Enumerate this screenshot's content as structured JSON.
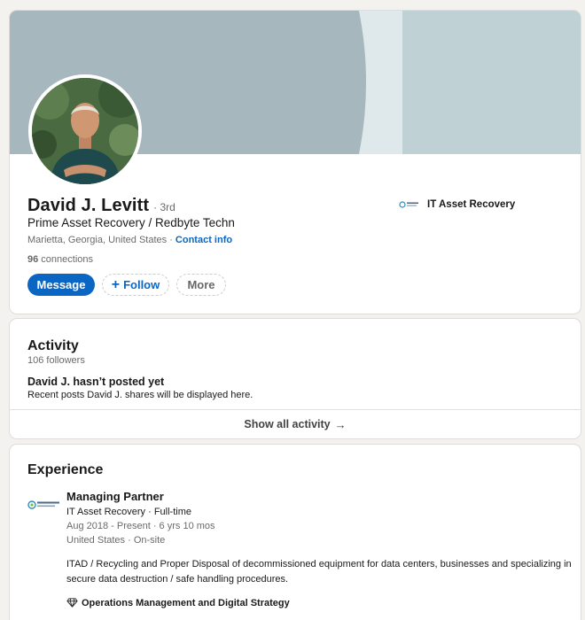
{
  "profile": {
    "name": "David J. Levitt",
    "degree": "· 3rd",
    "headline": "Prime Asset Recovery / Redbyte Techn",
    "location": "Marietta, Georgia, United States",
    "location_sep": " · ",
    "contact_label": "Contact info",
    "connections_count": "96",
    "connections_label": " connections",
    "current_company": "IT Asset Recovery"
  },
  "actions": {
    "message_label": "Message",
    "follow_icon": "+",
    "follow_label": "Follow",
    "more_label": "More"
  },
  "activity": {
    "title": "Activity",
    "followers": "106 followers",
    "empty_title": "David J. hasn’t posted yet",
    "empty_sub": "Recent posts David J. shares will be displayed here.",
    "show_all_label": "Show all activity",
    "show_all_icon": "→"
  },
  "experience": {
    "title": "Experience",
    "items": [
      {
        "title": "Managing Partner",
        "company": "IT Asset Recovery · Full-time",
        "dates": "Aug 2018 - Present · 6 yrs 10 mos",
        "location": "United States · On-site",
        "description": "ITAD / Recycling and Proper Disposal of decommissioned equipment for data centers, businesses and specializing in secure data destruction / safe handling procedures.",
        "skills": "Operations Management and Digital Strategy"
      }
    ]
  },
  "colors": {
    "accent": "#0a66c2",
    "page_bg": "#f4f2ee",
    "banner_dark": "#a6b8bd",
    "banner_light": "#dfe8ea",
    "banner_right": "#c0d1d6"
  },
  "icons": {
    "follow": "plus-icon",
    "show_all": "arrow-right-icon",
    "skills": "diamond-icon"
  }
}
